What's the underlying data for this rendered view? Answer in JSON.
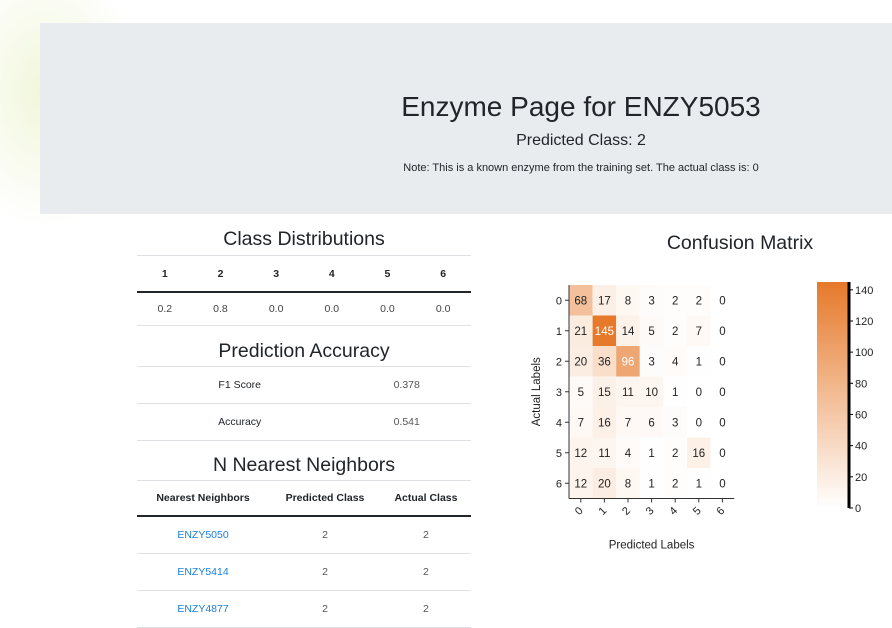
{
  "header": {
    "title": "Enzyme Page for ENZY5053",
    "predicted": "Predicted Class: 2",
    "note": "Note: This is a known enzyme from the training set. The actual class is: 0"
  },
  "class_distributions": {
    "title": "Class Distributions",
    "headers": [
      "1",
      "2",
      "3",
      "4",
      "5",
      "6"
    ],
    "values": [
      "0.2",
      "0.8",
      "0.0",
      "0.0",
      "0.0",
      "0.0"
    ]
  },
  "prediction_accuracy": {
    "title": "Prediction Accuracy",
    "rows": [
      {
        "label": "F1 Score",
        "value": "0.378"
      },
      {
        "label": "Accuracy",
        "value": "0.541"
      }
    ]
  },
  "nearest_neighbors": {
    "title": "N Nearest Neighbors",
    "headers": [
      "Nearest Neighbors",
      "Predicted Class",
      "Actual Class"
    ],
    "rows": [
      {
        "id": "ENZY5050",
        "predicted": "2",
        "actual": "2"
      },
      {
        "id": "ENZY5414",
        "predicted": "2",
        "actual": "2"
      },
      {
        "id": "ENZY4877",
        "predicted": "2",
        "actual": "2"
      }
    ]
  },
  "chart_data": {
    "type": "heatmap",
    "title": "Confusion Matrix",
    "xlabel": "Predicted Labels",
    "ylabel": "Actual Labels",
    "x_ticks": [
      "0",
      "1",
      "2",
      "3",
      "4",
      "5",
      "6"
    ],
    "y_ticks": [
      "0",
      "1",
      "2",
      "3",
      "4",
      "5",
      "6"
    ],
    "matrix": [
      [
        68,
        17,
        8,
        3,
        2,
        2,
        0
      ],
      [
        21,
        145,
        14,
        5,
        2,
        7,
        0
      ],
      [
        20,
        36,
        96,
        3,
        4,
        1,
        0
      ],
      [
        5,
        15,
        11,
        10,
        1,
        0,
        0
      ],
      [
        7,
        16,
        7,
        6,
        3,
        0,
        0
      ],
      [
        12,
        11,
        4,
        1,
        2,
        16,
        0
      ],
      [
        12,
        20,
        8,
        1,
        2,
        1,
        0
      ]
    ],
    "colorbar_ticks": [
      140,
      120,
      100,
      80,
      60,
      40,
      20,
      0
    ],
    "colorbar_range": [
      0,
      145
    ],
    "colormap": {
      "low": "#ffffff",
      "high": "#e6792a"
    }
  }
}
